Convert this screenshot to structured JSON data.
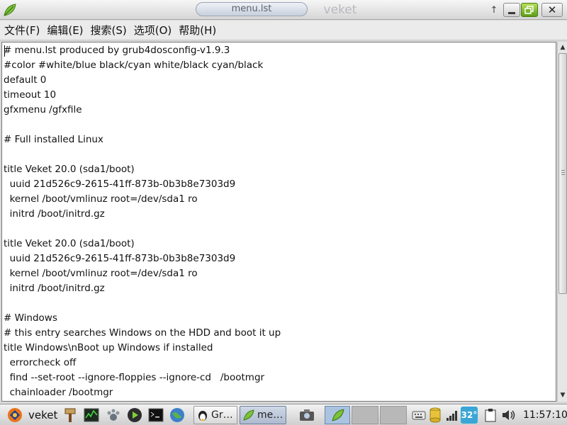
{
  "window": {
    "tab_label": "menu.lst",
    "title": "veket",
    "pin_glyph": "↑",
    "close_glyph": "✕"
  },
  "menu": [
    {
      "label": "文件(F)"
    },
    {
      "label": "编辑(E)"
    },
    {
      "label": "搜索(S)"
    },
    {
      "label": "选项(O)"
    },
    {
      "label": "帮助(H)"
    }
  ],
  "editor": {
    "lines": [
      "# menu.lst produced by grub4dosconfig-v1.9.3",
      "#color #white/blue black/cyan white/black cyan/black",
      "default 0",
      "timeout 10",
      "gfxmenu /gfxfile",
      "",
      "# Full installed Linux",
      "",
      "title Veket 20.0 (sda1/boot)",
      "  uuid 21d526c9-2615-41ff-873b-0b3b8e7303d9",
      "  kernel /boot/vmlinuz root=/dev/sda1 ro",
      "  initrd /boot/initrd.gz",
      "",
      "title Veket 20.0 (sda1/boot)",
      "  uuid 21d526c9-2615-41ff-873b-0b3b8e7303d9",
      "  kernel /boot/vmlinuz root=/dev/sda1 ro",
      "  initrd /boot/initrd.gz",
      "",
      "# Windows",
      "# this entry searches Windows on the HDD and boot it up",
      "title Windows\\nBoot up Windows if installed",
      "  errorcheck off",
      "  find --set-root --ignore-floppies --ignore-cd   /bootmgr",
      "  chainloader /bootmgr"
    ]
  },
  "taskbar": {
    "start_label": "veket",
    "tasks": [
      {
        "label": "Gr…",
        "icon": "terminal-icon"
      },
      {
        "label": "me…",
        "icon": "leaf-icon"
      }
    ],
    "temperature": "32°",
    "clock": "11:57:10"
  },
  "colors": {
    "accent_green": "#6db52a",
    "titlebar_bg": "#e2e2e2",
    "editor_bg": "#ffffff",
    "temp_badge": "#3aa6d6"
  }
}
